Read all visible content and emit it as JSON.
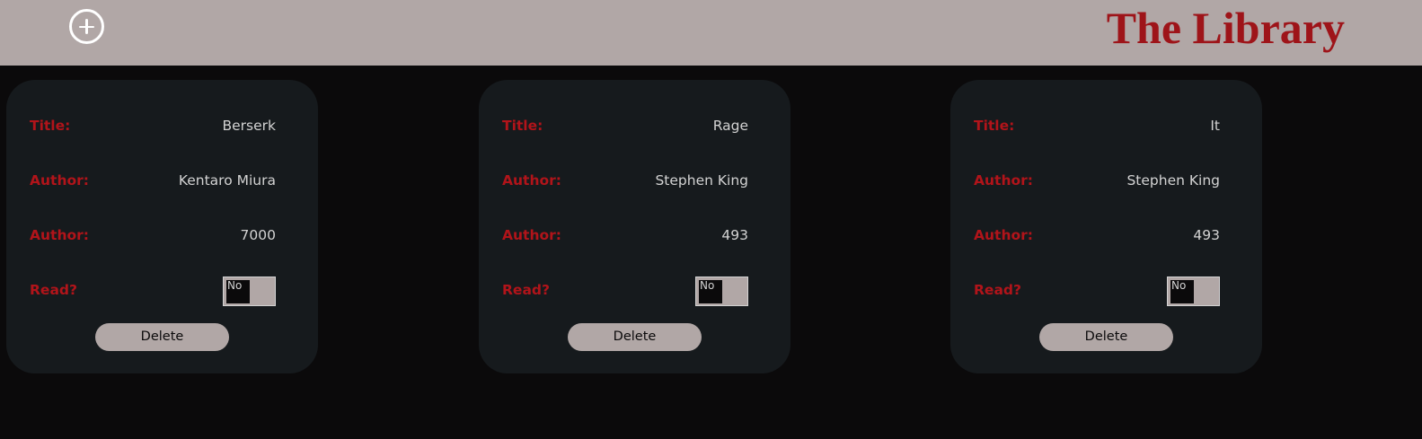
{
  "header": {
    "title": "The Library",
    "add_icon": "plus-circle-icon"
  },
  "colors": {
    "header_bg": "#b1a7a6",
    "page_bg": "#0b0a0b",
    "card_bg": "#161a1d",
    "label_red": "#b1141a",
    "title_red": "#9e1419"
  },
  "labels": {
    "title": "Title:",
    "author": "Author:",
    "pages": "Author:",
    "read": "Read?",
    "delete": "Delete"
  },
  "books": [
    {
      "title": "Berserk",
      "author": "Kentaro Miura",
      "pages": "7000",
      "read": "No"
    },
    {
      "title": "Rage",
      "author": "Stephen King",
      "pages": "493",
      "read": "No"
    },
    {
      "title": "It",
      "author": "Stephen King",
      "pages": "493",
      "read": "No"
    }
  ]
}
